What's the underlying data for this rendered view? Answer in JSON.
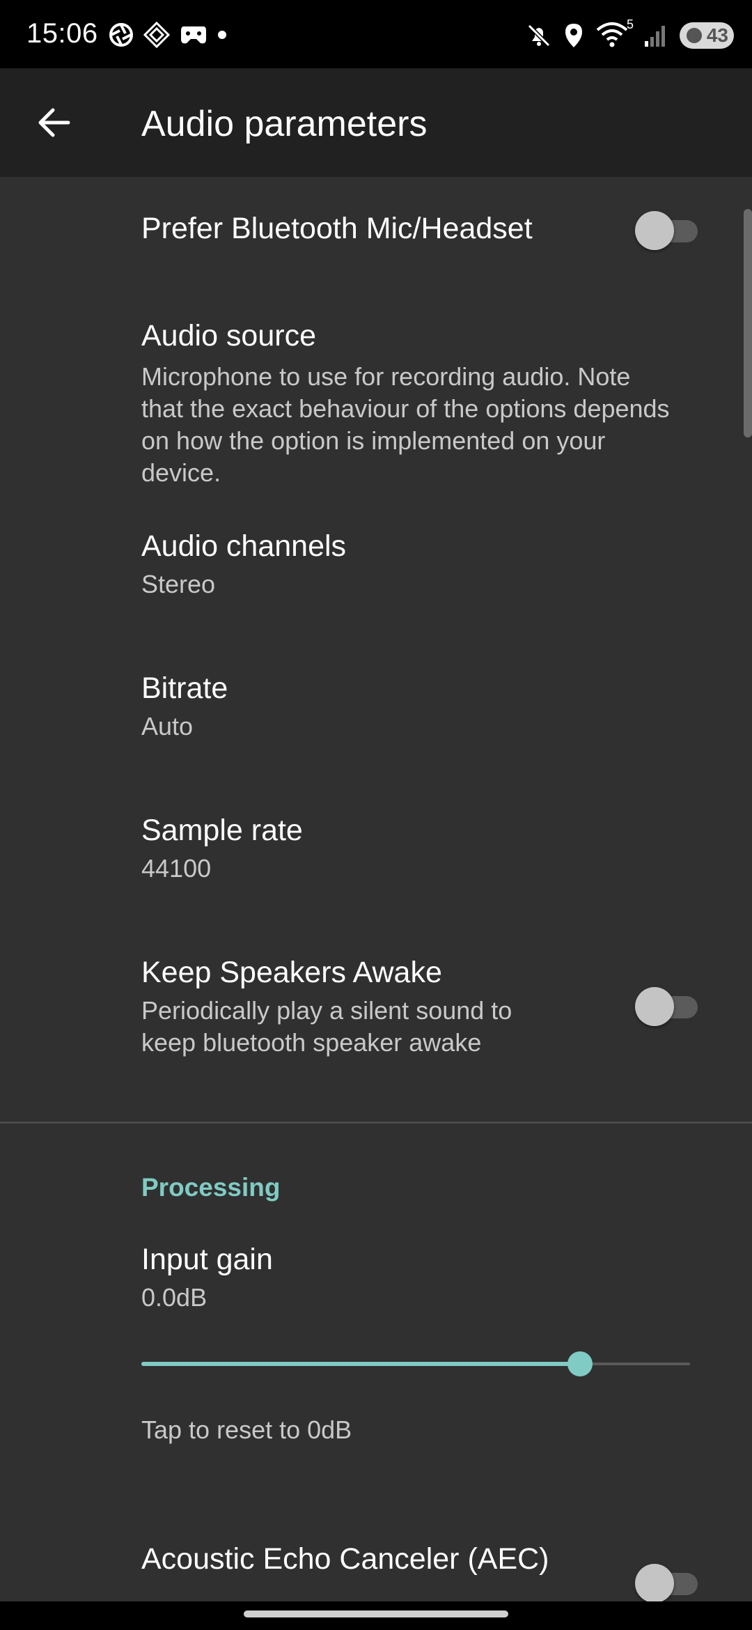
{
  "status_bar": {
    "time": "15:06",
    "battery": "43",
    "left_icons": [
      "aperture-icon",
      "diamond-app-icon",
      "game-controller-icon",
      "dot-icon"
    ],
    "right_icons": [
      "mute-icon",
      "location-icon",
      "wifi-icon",
      "signal-icon"
    ],
    "wifi_badge": "5"
  },
  "app_bar": {
    "title": "Audio parameters"
  },
  "preferences": {
    "prefer_bluetooth": {
      "title": "Prefer Bluetooth Mic/Headset",
      "enabled": false
    },
    "audio_source": {
      "title": "Audio source",
      "summary_lines": [
        "Microphone to use for recording audio. Note",
        "that the exact behaviour of the options depends",
        "on how the option is implemented on your",
        "device."
      ]
    },
    "audio_channels": {
      "title": "Audio channels",
      "value": "Stereo"
    },
    "bitrate": {
      "title": "Bitrate",
      "value": "Auto"
    },
    "sample_rate": {
      "title": "Sample rate",
      "value": "44100"
    },
    "keep_speakers_awake": {
      "title": "Keep Speakers Awake",
      "summary_lines": [
        "Periodically play a silent sound to",
        "keep bluetooth speaker awake"
      ],
      "enabled": false
    }
  },
  "processing": {
    "header": "Processing",
    "input_gain": {
      "title": "Input gain",
      "value": "0.0dB",
      "slider_fraction": 0.8
    },
    "reset_hint": "Tap to reset to 0dB",
    "aec": {
      "title": "Acoustic Echo Canceler (AEC)",
      "enabled": false
    }
  },
  "colors": {
    "accent": "#80cbc4",
    "background": "#303030",
    "app_bar": "#212121"
  }
}
